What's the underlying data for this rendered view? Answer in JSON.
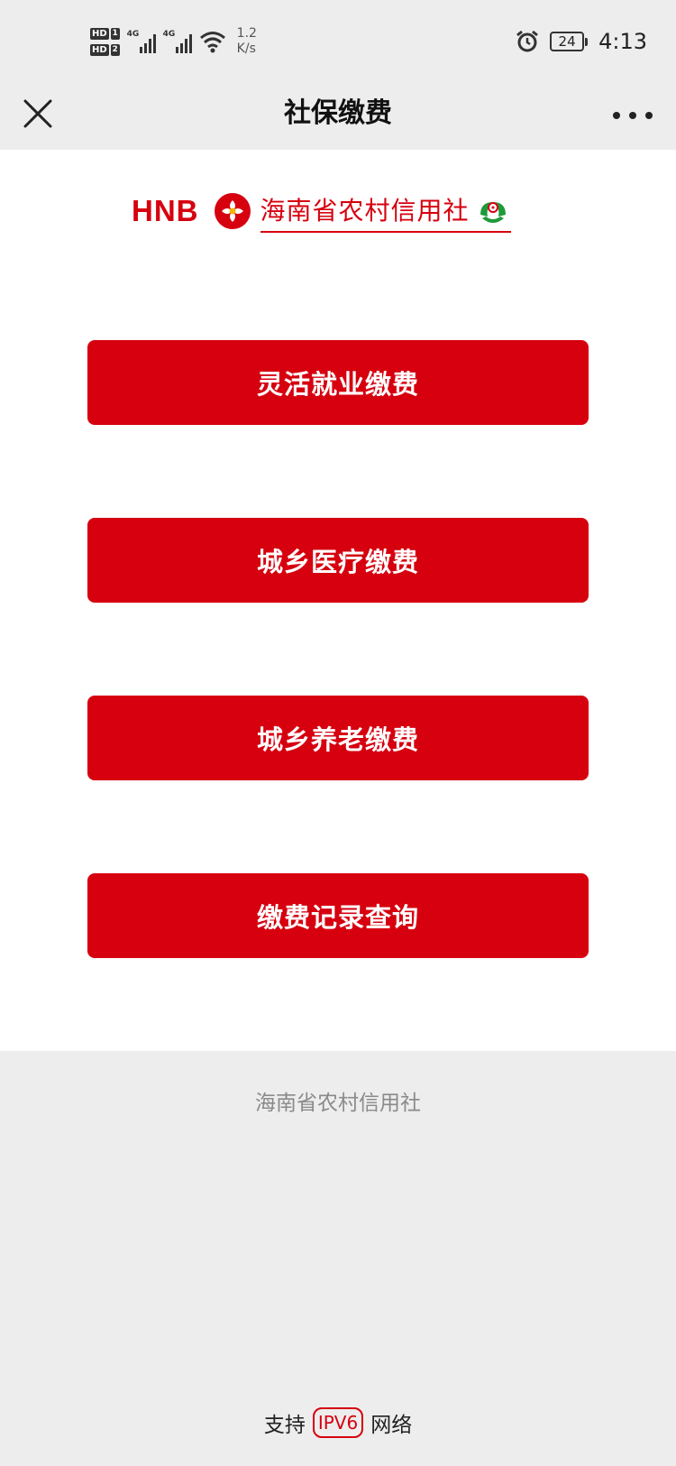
{
  "status_bar": {
    "hd1": "HD",
    "sim1": "1",
    "hd2": "HD",
    "sim2": "2",
    "net1": "4G",
    "net2": "4G",
    "speed_value": "1.2",
    "speed_unit": "K/s",
    "battery": "24",
    "time": "4:13"
  },
  "nav": {
    "title": "社保缴费"
  },
  "logo": {
    "abbr": "HNB",
    "name": "海南省农村信用社"
  },
  "buttons": [
    {
      "label": "灵活就业缴费"
    },
    {
      "label": "城乡医疗缴费"
    },
    {
      "label": "城乡养老缴费"
    },
    {
      "label": "缴费记录查询"
    }
  ],
  "footer": {
    "org": "海南省农村信用社",
    "support_prefix": "支持",
    "ipv6": "IPV6",
    "support_suffix": "网络"
  },
  "colors": {
    "brand_red": "#d6000f",
    "logo_green": "#1f9a3a",
    "page_bg": "#ededed",
    "content_bg": "#ffffff"
  },
  "icons": [
    "close-icon",
    "more-icon",
    "alarm-icon",
    "wifi-icon",
    "signal-icon",
    "battery-icon",
    "hnb-logo-mark-icon",
    "rcc-green-emblem-icon"
  ]
}
